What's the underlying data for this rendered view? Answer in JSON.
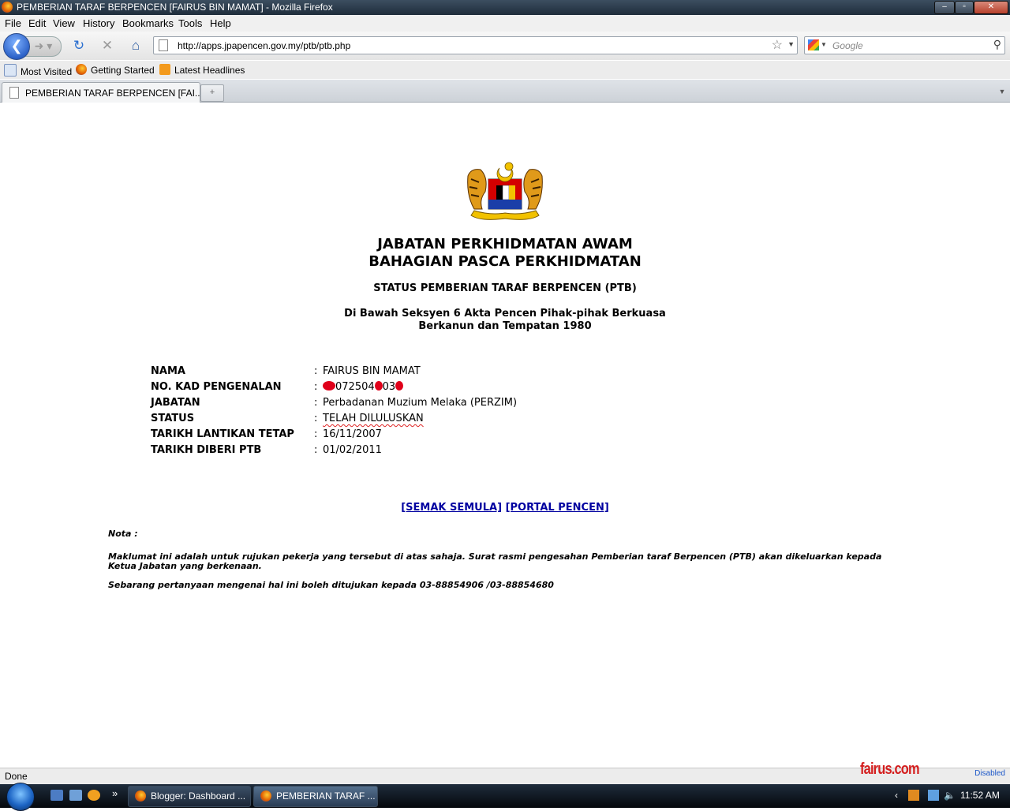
{
  "window": {
    "title": "PEMBERIAN TARAF BERPENCEN [FAIRUS BIN MAMAT] - Mozilla Firefox",
    "controls": {
      "minimize": "–",
      "maximize": "▫",
      "close": "✕"
    }
  },
  "menu": [
    "File",
    "Edit",
    "View",
    "History",
    "Bookmarks",
    "Tools",
    "Help"
  ],
  "toolbar": {
    "url": "http://apps.jpapencen.gov.my/ptb/ptb.php",
    "search_placeholder": "Google"
  },
  "bookmarks": [
    "Most Visited",
    "Getting Started",
    "Latest Headlines"
  ],
  "tabs": [
    {
      "label": "PEMBERIAN TARAF BERPENCEN [FAI..."
    }
  ],
  "page": {
    "heading1": "JABATAN PERKHIDMATAN AWAM",
    "heading2": "BAHAGIAN PASCA PERKHIDMATAN",
    "subheading": "STATUS PEMBERIAN TARAF BERPENCEN (PTB)",
    "law_line1": "Di Bawah Seksyen 6 Akta Pencen Pihak-pihak Berkuasa",
    "law_line2": "Berkanun dan Tempatan 1980",
    "fields": [
      {
        "label": "NAMA",
        "value": "FAIRUS BIN MAMAT"
      },
      {
        "label": "NO. KAD PENGENALAN",
        "value_parts": [
          "072504",
          "03"
        ]
      },
      {
        "label": "JABATAN",
        "value": "Perbadanan Muzium Melaka (PERZIM)"
      },
      {
        "label": "STATUS",
        "value": "TELAH DILULUSKAN"
      },
      {
        "label": "TARIKH LANTIKAN TETAP",
        "value": "16/11/2007"
      },
      {
        "label": "TARIKH DIBERI PTB",
        "value": "01/02/2011"
      }
    ],
    "colon": ":",
    "links": {
      "semak": "[SEMAK SEMULA]",
      "portal": "[PORTAL PENCEN]"
    },
    "note_title": "Nota :",
    "note1": "Maklumat ini adalah untuk rujukan pekerja yang tersebut di atas sahaja. Surat rasmi pengesahan Pemberian taraf Berpencen (PTB) akan dikeluarkan kepada Ketua Jabatan yang berkenaan.",
    "note2": "Sebarang pertanyaan mengenai hal ini boleh ditujukan kepada 03-88854906 /03-88854680"
  },
  "statusbar": {
    "text": "Done",
    "right": "Disabled",
    "watermark": "fairus.com"
  },
  "taskbar": {
    "items": [
      "Blogger: Dashboard ...",
      "PEMBERIAN TARAF ..."
    ],
    "overflow": "»",
    "tray_arrow": "‹",
    "clock": "11:52 AM"
  },
  "colors": {
    "link": "#0000a0",
    "redaction": "#e0001a",
    "titlebar": "#2b3a4a"
  }
}
